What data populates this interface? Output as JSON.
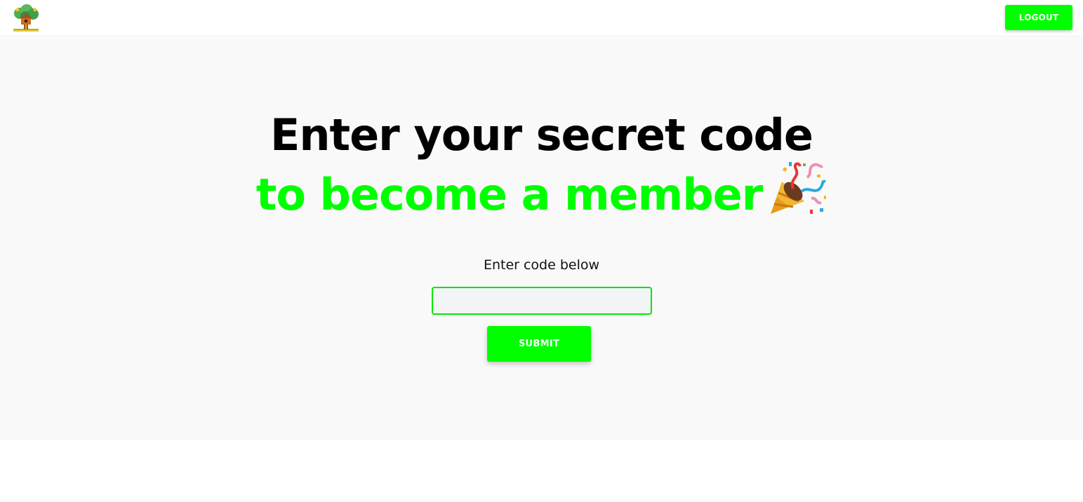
{
  "header": {
    "logo_icon": "treehouse-icon",
    "logout_label": "LOGOUT"
  },
  "hero": {
    "line1": "Enter your secret code",
    "line2": "to become a member",
    "emoji_icon": "party-popper-icon"
  },
  "form": {
    "label": "Enter code below",
    "input_value": "",
    "input_placeholder": "",
    "submit_label": "SUBMIT"
  },
  "colors": {
    "accent": "#00ff00",
    "page_background": "#f9f9f9",
    "header_background": "#ffffff",
    "input_background": "#f3f4f6",
    "heading_text": "#000000"
  }
}
